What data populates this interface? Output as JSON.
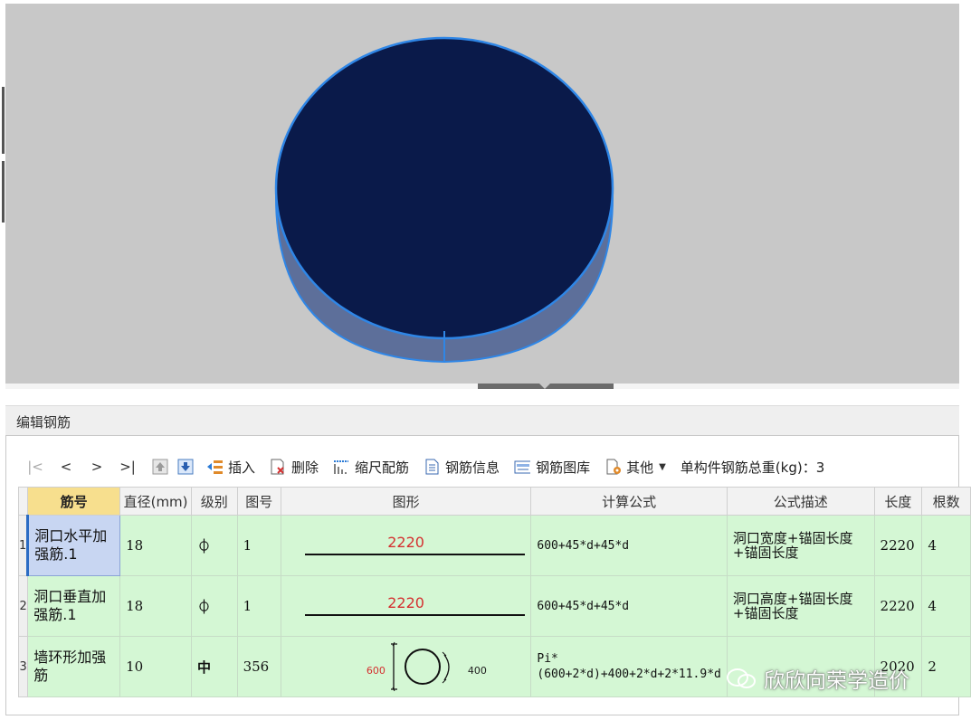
{
  "panel": {
    "title": "编辑钢筋"
  },
  "toolbar": {
    "nav": [
      "|<",
      "<",
      ">",
      ">|"
    ],
    "insert_label": "插入",
    "delete_label": "删除",
    "scale_rebar_label": "缩尺配筋",
    "rebar_info_label": "钢筋信息",
    "rebar_library_label": "钢筋图库",
    "other_label": "其他",
    "total_weight_label": "单构件钢筋总重(kg)：3"
  },
  "grid": {
    "headers": {
      "name": "筋号",
      "diameter": "直径(mm)",
      "grade": "级别",
      "shape_no": "图号",
      "shape": "图形",
      "formula": "计算公式",
      "description": "公式描述",
      "length": "长度",
      "count": "根数"
    },
    "rows": [
      {
        "num": "1",
        "name": "洞口水平加强筋.1",
        "diameter": "18",
        "grade": "⏀",
        "shape_no": "1",
        "shape_length": "2220",
        "formula": "600+45*d+45*d",
        "description": "洞口宽度+锚固长度+锚固长度",
        "length": "2220",
        "count": "4"
      },
      {
        "num": "2",
        "name": "洞口垂直加强筋.1",
        "diameter": "18",
        "grade": "⏀",
        "shape_no": "1",
        "shape_length": "2220",
        "formula": "600+45*d+45*d",
        "description": "洞口高度+锚固长度+锚固长度",
        "length": "2220",
        "count": "4"
      },
      {
        "num": "3",
        "name": "墙环形加强筋",
        "diameter": "10",
        "grade": "中",
        "shape_no": "356",
        "shape_dim_left": "600",
        "shape_dim_right": "400",
        "formula": "Pi*(600+2*d)+400+2*d+2*11.9*d",
        "description": "",
        "length": "2020",
        "count": "2"
      }
    ]
  },
  "watermark": {
    "text": "欣欣向荣学造价"
  },
  "colors": {
    "viewport_bg": "#c8c8c8",
    "cylinder_top": "#0a1a4a",
    "cylinder_side": "#5d6f9a",
    "cylinder_edge": "#2f86e6",
    "row_green": "#d4f7d4",
    "header_highlight": "#f7df8e",
    "shape_red": "#d43030"
  }
}
